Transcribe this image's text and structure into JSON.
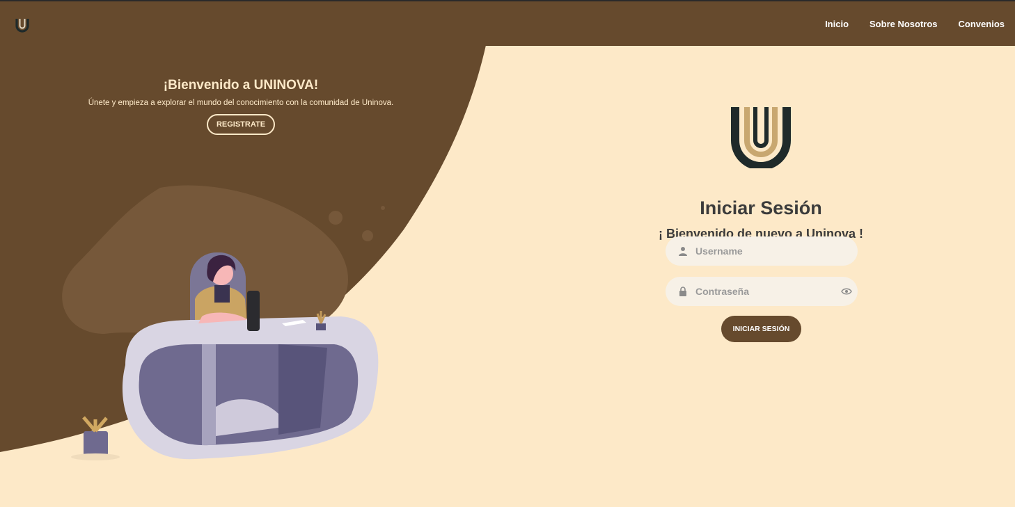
{
  "colors": {
    "brown": "#664a2d",
    "cream": "#fde9c8",
    "gold": "#c8a770",
    "dark": "#1f2a2a"
  },
  "nav": {
    "logo_icon": "u-logo-icon",
    "links": [
      {
        "label": "Inicio"
      },
      {
        "label": "Sobre Nosotros"
      },
      {
        "label": "Convenios"
      }
    ]
  },
  "welcome": {
    "title": "¡Bienvenido a UNINOVA!",
    "subtitle": "Únete y empieza a explorar el mundo del conocimiento con la comunidad de Uninova.",
    "register_label": "REGISTRATE"
  },
  "login": {
    "logo_icon": "u-logo-icon",
    "title": "Iniciar Sesión",
    "subtitle": "¡ Bienvenido de nuevo a Uninova !",
    "username": {
      "placeholder": "Username",
      "value": "",
      "icon": "user-icon"
    },
    "password": {
      "placeholder": "Contraseña",
      "value": "",
      "icon": "lock-icon",
      "toggle_icon": "eye-icon"
    },
    "submit_label": "INICIAR SESIÓN"
  },
  "illustration": {
    "icon": "person-at-desk-illustration"
  }
}
